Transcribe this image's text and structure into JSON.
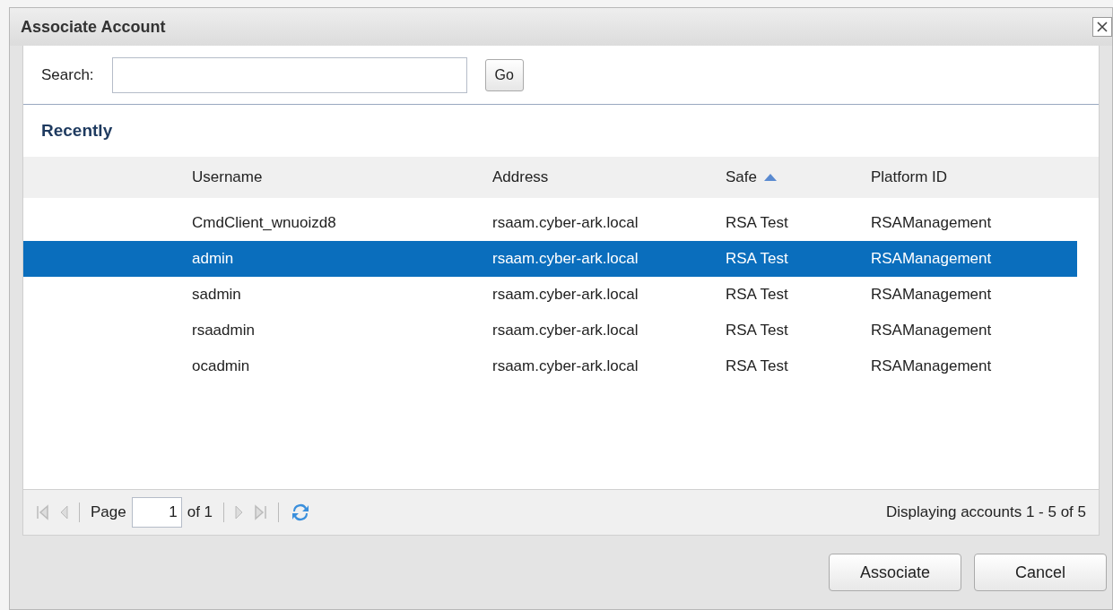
{
  "dialog": {
    "title": "Associate Account"
  },
  "search": {
    "label": "Search:",
    "button": "Go"
  },
  "section_title": "Recently",
  "table": {
    "columns": [
      {
        "label": "Username",
        "sorted": false
      },
      {
        "label": "Address",
        "sorted": false
      },
      {
        "label": "Safe",
        "sorted": true
      },
      {
        "label": "Platform ID",
        "sorted": false
      }
    ],
    "rows": [
      {
        "cells": [
          "CmdClient_wnuoizd8",
          "rsaam.cyber-ark.local",
          "RSA Test",
          "RSAManagement"
        ],
        "selected": false
      },
      {
        "cells": [
          "admin",
          "rsaam.cyber-ark.local",
          "RSA Test",
          "RSAManagement"
        ],
        "selected": true
      },
      {
        "cells": [
          "sadmin",
          "rsaam.cyber-ark.local",
          "RSA Test",
          "RSAManagement"
        ],
        "selected": false
      },
      {
        "cells": [
          "rsaadmin",
          "rsaam.cyber-ark.local",
          "RSA Test",
          "RSAManagement"
        ],
        "selected": false
      },
      {
        "cells": [
          "ocadmin",
          "rsaam.cyber-ark.local",
          "RSA Test",
          "RSAManagement"
        ],
        "selected": false
      }
    ]
  },
  "pager": {
    "page_label": "Page",
    "page": "1",
    "of": "of 1",
    "summary": "Displaying accounts 1 - 5 of 5"
  },
  "buttons": [
    "Associate",
    "Cancel"
  ]
}
